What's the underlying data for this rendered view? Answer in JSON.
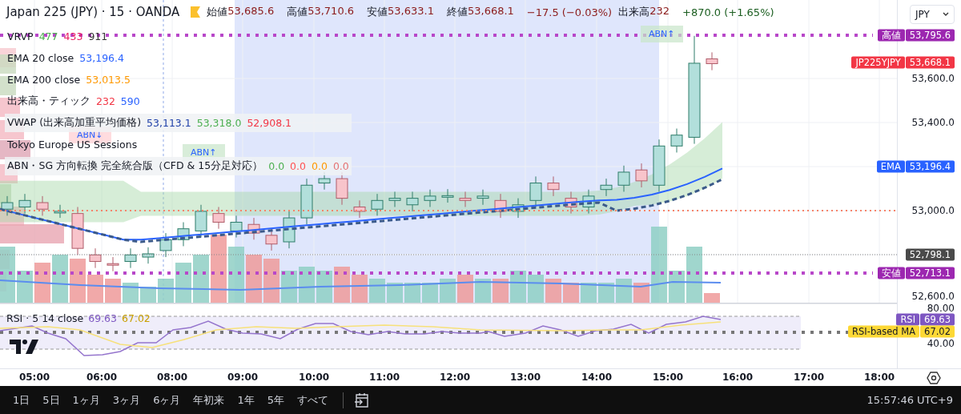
{
  "symbol": {
    "title": "Japan 225 (JPY) · 15 · OANDA"
  },
  "ohlc": [
    {
      "label": "始値",
      "value": "53,685.6"
    },
    {
      "label": "高値",
      "value": "53,710.6"
    },
    {
      "label": "安値",
      "value": "53,633.1"
    },
    {
      "label": "終値",
      "value": "53,668.1"
    }
  ],
  "change": "−17.5 (−0.03%)",
  "volume": {
    "label": "出来高",
    "value": "232"
  },
  "day_change": "+870.0 (+1.65%)",
  "currency": "JPY",
  "indicators": [
    {
      "name": "VRVP",
      "values": [
        {
          "text": "477",
          "color": "#4caf50"
        },
        {
          "text": "433",
          "color": "#e91e63"
        },
        {
          "text": "911",
          "color": "#333333"
        }
      ]
    },
    {
      "name": "EMA 20 close",
      "values": [
        {
          "text": "53,196.4",
          "color": "#2962ff"
        }
      ]
    },
    {
      "name": "EMA 200 close",
      "values": [
        {
          "text": "53,013.5",
          "color": "#ff9800"
        }
      ]
    },
    {
      "name": "出来高・ティック",
      "values": [
        {
          "text": "232",
          "color": "#f23645"
        },
        {
          "text": "590",
          "color": "#2962ff"
        }
      ]
    },
    {
      "name": "VWAP (出来高加重平均価格)",
      "values": [
        {
          "text": "53,113.1",
          "color": "#1e3fa8"
        },
        {
          "text": "53,318.0",
          "color": "#4caf50"
        },
        {
          "text": "52,908.1",
          "color": "#f23645"
        }
      ]
    },
    {
      "name": "Tokyo Europe US Sessions"
    },
    {
      "name": "ABN・SG 方向転換 完全統合版（CFD & 15分足対応）",
      "values": [
        {
          "text": "0.0",
          "color": "#4caf50"
        },
        {
          "text": "0.0",
          "color": "#ff5252"
        },
        {
          "text": "0.0",
          "color": "#ff9800"
        },
        {
          "text": "0.0",
          "color": "#e57373"
        }
      ]
    }
  ],
  "signals": [
    {
      "text": "ABN↓",
      "kind": "down"
    },
    {
      "text": "ABN↑",
      "kind": "up"
    },
    {
      "text": "ABN↑",
      "kind": "up"
    }
  ],
  "price_axis": [
    {
      "kind": "tag",
      "label": "高値",
      "value": "53,795.6",
      "color": "#9c27b0"
    },
    {
      "kind": "tag",
      "label": "JP225YJPY",
      "value": "53,668.1",
      "color": "#f23645"
    },
    {
      "kind": "tick",
      "value": "53,600.0"
    },
    {
      "kind": "tick",
      "value": "53,400.0"
    },
    {
      "kind": "tag",
      "label": "EMA",
      "value": "53,196.4",
      "color": "#2962ff"
    },
    {
      "kind": "tick",
      "value": "53,000.0"
    },
    {
      "kind": "tag",
      "value": "52,798.1",
      "color": "#4a4a4a"
    },
    {
      "kind": "tag",
      "label": "安値",
      "value": "52,713.1",
      "color": "#9c27b0"
    },
    {
      "kind": "tick",
      "value": "52,600.0"
    }
  ],
  "rsi": {
    "title": "RSI · 5 14 close",
    "values": [
      {
        "text": "69.63",
        "color": "#7e57c2"
      },
      {
        "text": "67.02",
        "color": "#c9a000"
      }
    ],
    "axis": [
      {
        "kind": "tick",
        "value": "80.00"
      },
      {
        "kind": "tag",
        "label": "RSI",
        "value": "69.63",
        "color": "#7e57c2"
      },
      {
        "kind": "tag",
        "label": "RSI-based MA",
        "value": "67.02",
        "color": "#fdd835"
      },
      {
        "kind": "tick",
        "value": "40.00"
      }
    ]
  },
  "time_axis": [
    "05:00",
    "06:00",
    "08:00",
    "09:00",
    "10:00",
    "11:00",
    "12:00",
    "13:00",
    "14:00",
    "15:00",
    "16:00",
    "17:00",
    "18:00"
  ],
  "ranges": [
    "1日",
    "5日",
    "1ヶ月",
    "3ヶ月",
    "6ヶ月",
    "年初来",
    "1年",
    "5年",
    "すべて"
  ],
  "clock": "15:57:46 UTC+9"
}
